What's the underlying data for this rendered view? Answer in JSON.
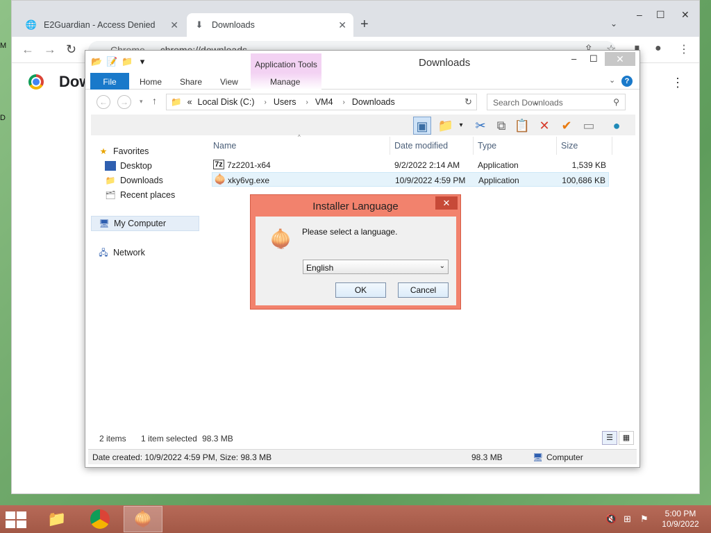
{
  "chrome": {
    "tabs": [
      {
        "title": "E2Guardian - Access Denied",
        "icon": "globe-icon"
      },
      {
        "title": "Downloads",
        "icon": "download-icon"
      }
    ],
    "omnibox_label": "Chrome",
    "url": "chrome://downloads",
    "page_title": "Dow"
  },
  "desktop": {
    "edge_labels": [
      "M",
      "D"
    ]
  },
  "explorer": {
    "quick_access_menu": "▾",
    "application_tools": "Application Tools",
    "title": "Downloads",
    "ribbon_tabs": [
      "File",
      "Home",
      "Share",
      "View",
      "Manage"
    ],
    "address": {
      "prefix": "«",
      "segments": [
        "Local Disk (C:)",
        "Users",
        "VM4",
        "Downloads"
      ]
    },
    "search_placeholder": "Search Downloads",
    "nav_pane": {
      "favorites": "Favorites",
      "favorites_items": [
        "Desktop",
        "Downloads",
        "Recent places"
      ],
      "my_computer": "My Computer",
      "network": "Network"
    },
    "columns": [
      "Name",
      "Date modified",
      "Type",
      "Size"
    ],
    "files": [
      {
        "name": "7z2201-x64",
        "date": "9/2/2022 2:14 AM",
        "type": "Application",
        "size": "1,539 KB",
        "icon": "7z"
      },
      {
        "name": "xky6vg.exe",
        "date": "10/9/2022 4:59 PM",
        "type": "Application",
        "size": "100,686 KB",
        "icon": "tor-onion-icon",
        "selected": true
      }
    ],
    "status": {
      "items": "2 items",
      "selected": "1 item selected",
      "selected_size": "98.3 MB"
    },
    "details_bar": {
      "info": "Date created: 10/9/2022 4:59 PM, Size: 98.3 MB",
      "size": "98.3 MB",
      "location": "Computer"
    }
  },
  "dialog": {
    "title": "Installer Language",
    "message": "Please select a language.",
    "selected_language": "English",
    "ok": "OK",
    "cancel": "Cancel",
    "accent": "#f2826d"
  },
  "taskbar": {
    "apps": [
      "file-explorer",
      "chrome",
      "tor-installer"
    ],
    "time": "5:00 PM",
    "date": "10/9/2022"
  }
}
